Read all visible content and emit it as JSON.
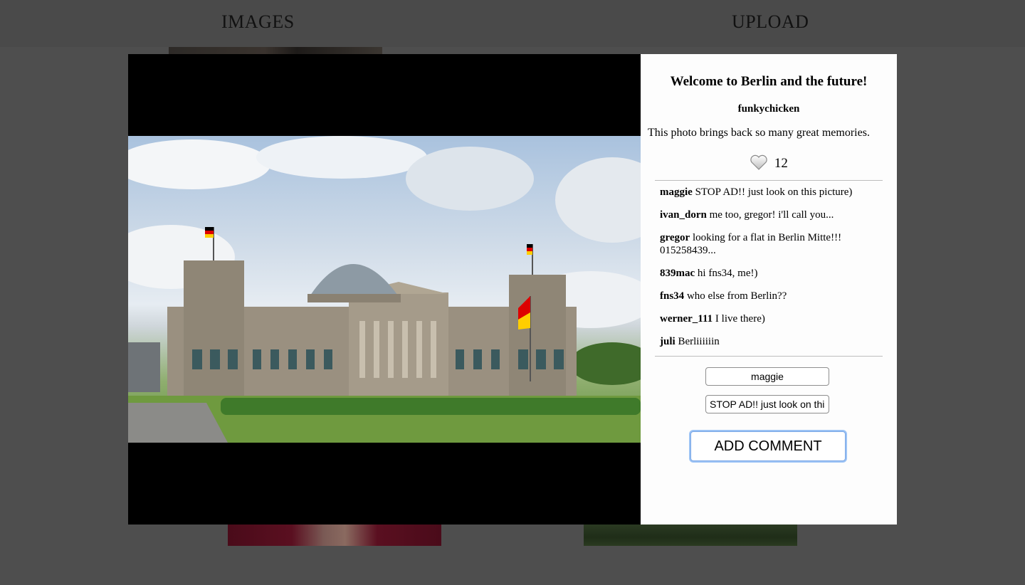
{
  "nav": {
    "images_label": "IMAGES",
    "upload_label": "UPLOAD"
  },
  "photo": {
    "title": "Welcome to Berlin and the future!",
    "author": "funkychicken",
    "description": "This photo brings back so many great memories.",
    "likes_count": "12",
    "like_icon": "heart-icon"
  },
  "comments": [
    {
      "user": "maggie",
      "text": "STOP AD!! just look on this picture)"
    },
    {
      "user": "ivan_dorn",
      "text": "me too, gregor! i'll call you..."
    },
    {
      "user": "gregor",
      "text": "looking for a flat in Berlin Mitte!!! 015258439..."
    },
    {
      "user": "839mac",
      "text": "hi fns34, me!)"
    },
    {
      "user": "fns34",
      "text": "who else from Berlin??"
    },
    {
      "user": "werner_111",
      "text": "I live there)"
    },
    {
      "user": "juli",
      "text": "Berliiiiiin"
    }
  ],
  "form": {
    "username_value": "maggie",
    "comment_value": "STOP AD!! just look on this picture)",
    "submit_label": "ADD COMMENT"
  },
  "colors": {
    "overlay": "#4e4e4e",
    "panel": "#fdfdfd",
    "focus": "#9cc3f5"
  }
}
